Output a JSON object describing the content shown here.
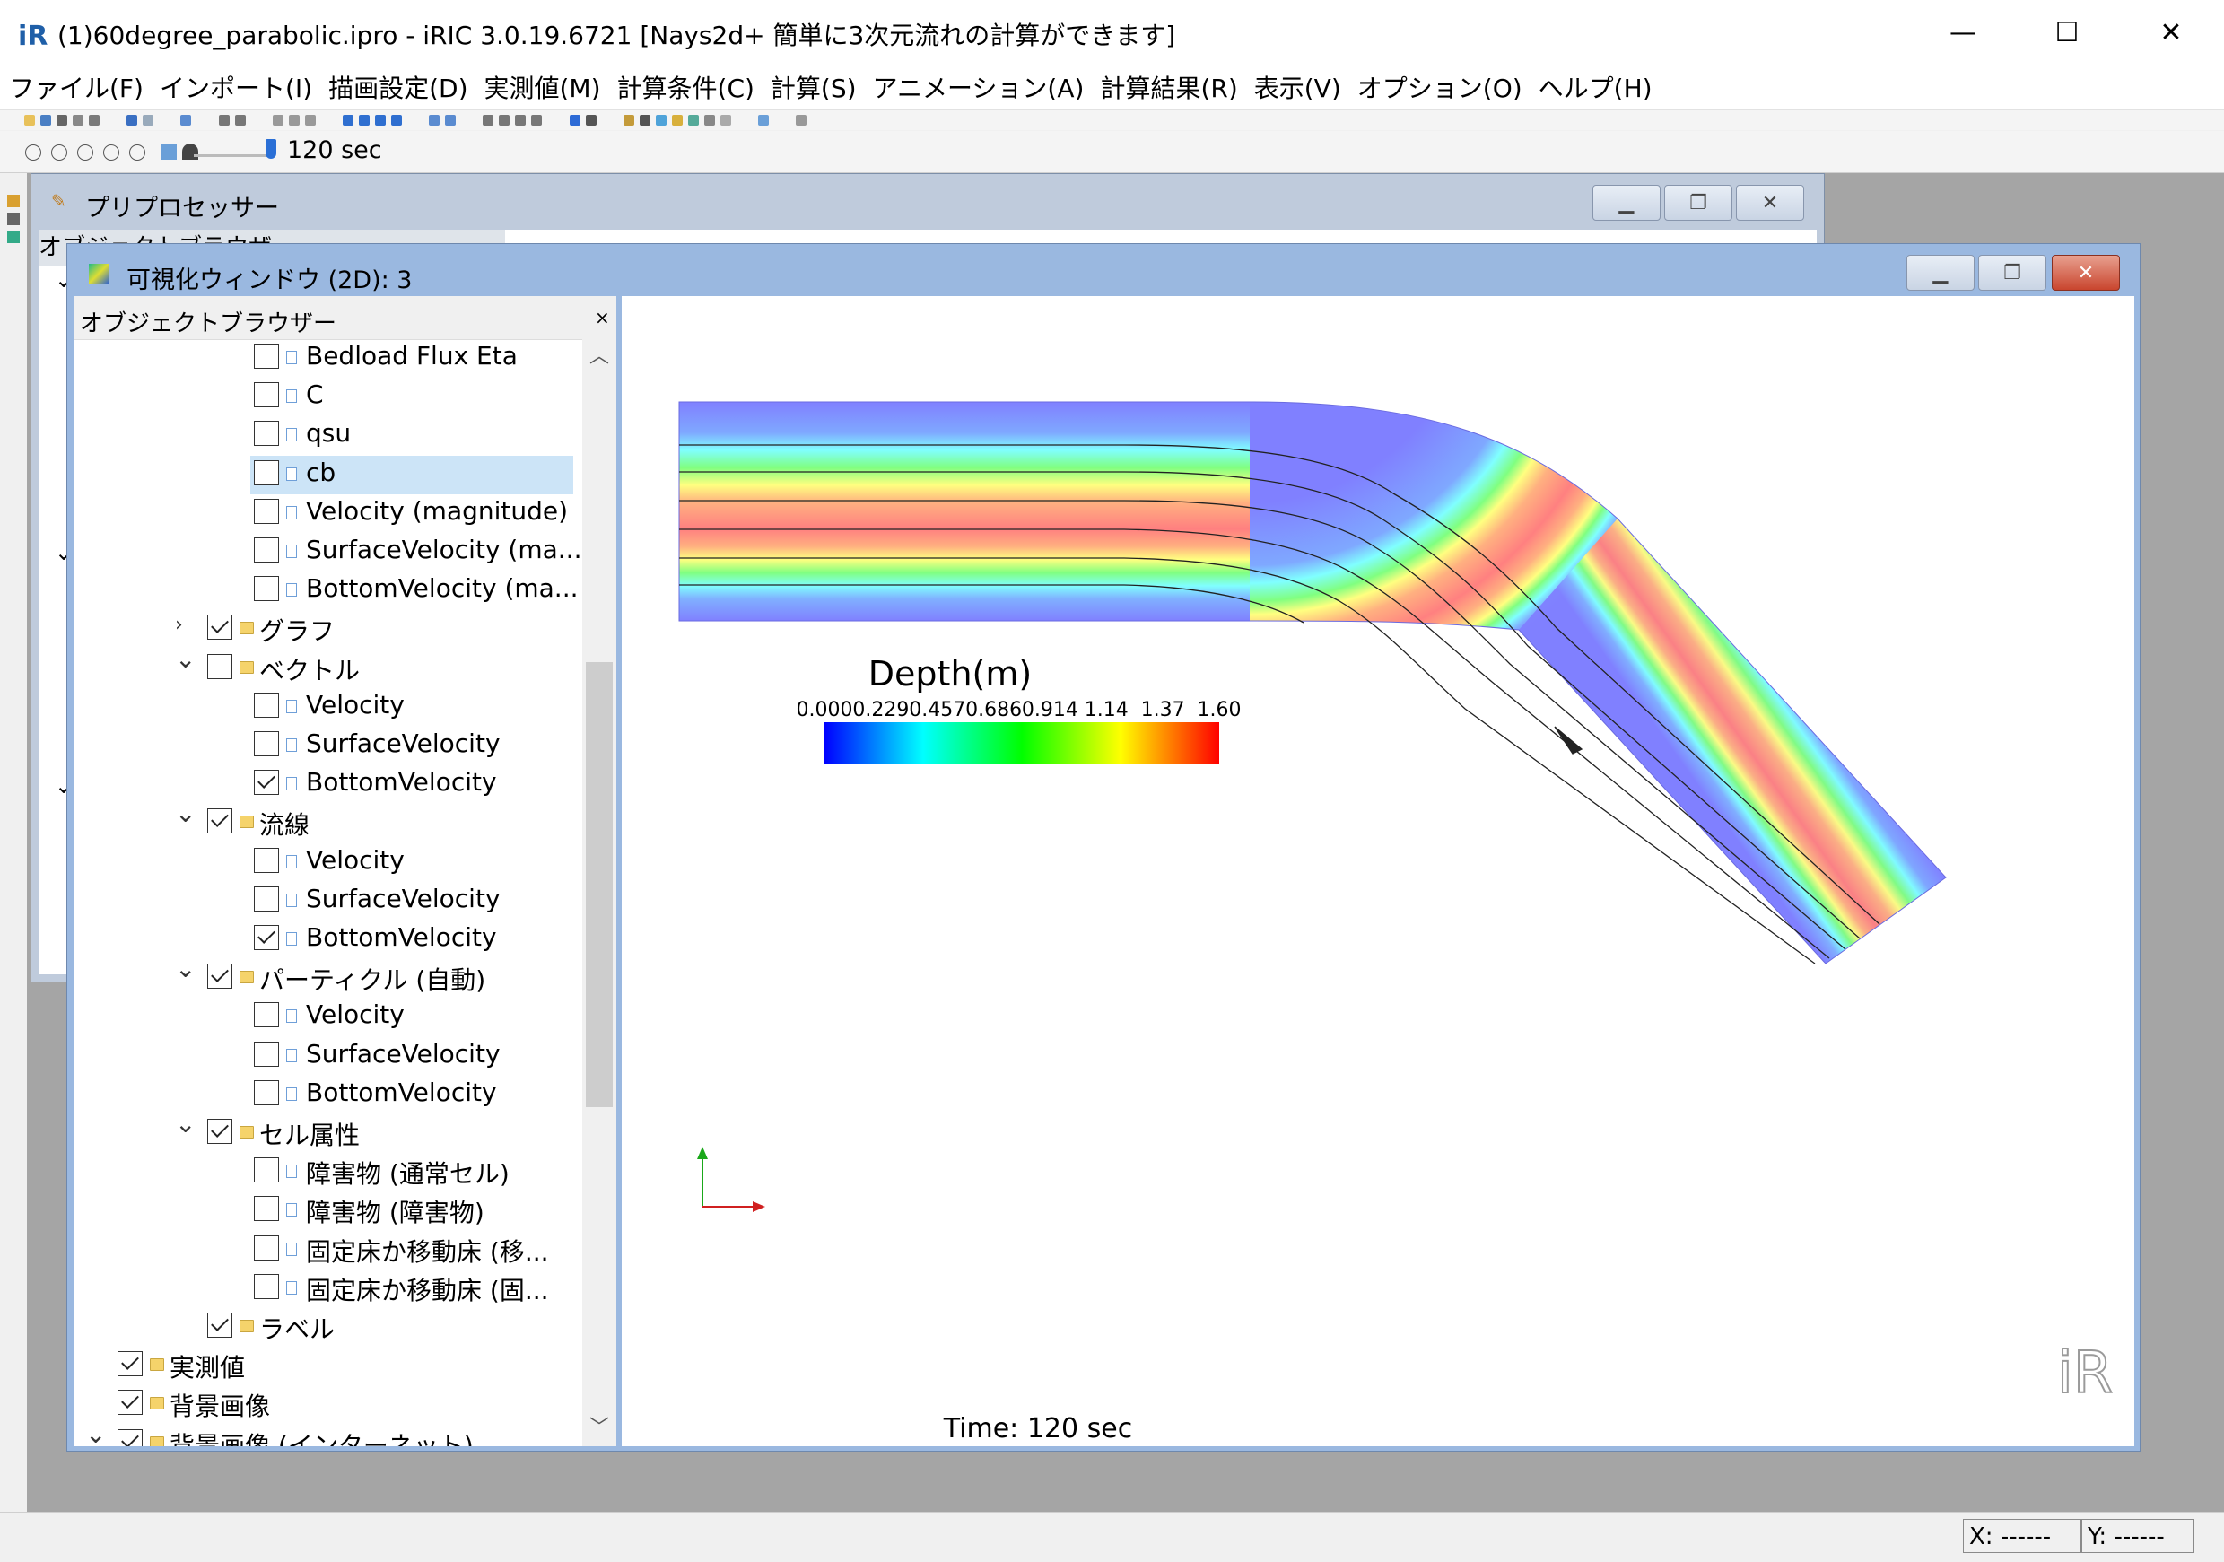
{
  "window": {
    "title": "(1)60degree_parabolic.ipro - iRIC 3.0.19.6721 [Nays2d+ 簡単に3次元流れの計算ができます]",
    "minimize": "—",
    "maximize": "☐",
    "close": "✕"
  },
  "menu": [
    "ファイル(F)",
    "インポート(I)",
    "描画設定(D)",
    "実測値(M)",
    "計算条件(C)",
    "計算(S)",
    "アニメーション(A)",
    "計算結果(R)",
    "表示(V)",
    "オプション(O)",
    "ヘルプ(H)"
  ],
  "animation": {
    "time_label": "120 sec"
  },
  "pre_window": {
    "title": "プリプロセッサー",
    "object_browser_title": "オブジェクトブラウザ"
  },
  "viz_window": {
    "title": "可視化ウィンドウ (2D): 3",
    "object_browser_title": "オブジェクトブラウザー",
    "close_x": "×"
  },
  "tree": [
    {
      "label": "Bedload Flux Eta",
      "level": 3,
      "checked": false,
      "icon": "doc"
    },
    {
      "label": "C",
      "level": 3,
      "checked": false,
      "icon": "doc"
    },
    {
      "label": "qsu",
      "level": 3,
      "checked": false,
      "icon": "doc"
    },
    {
      "label": "cb",
      "level": 3,
      "checked": false,
      "icon": "doc",
      "selected": true
    },
    {
      "label": "Velocity (magnitude)",
      "level": 3,
      "checked": false,
      "icon": "doc"
    },
    {
      "label": "SurfaceVelocity (ma...",
      "level": 3,
      "checked": false,
      "icon": "doc"
    },
    {
      "label": "BottomVelocity (ma...",
      "level": 3,
      "checked": false,
      "icon": "doc"
    },
    {
      "label": "グラフ",
      "level": 2,
      "checked": true,
      "icon": "folder",
      "expand": "collapsed"
    },
    {
      "label": "ベクトル",
      "level": 2,
      "checked": false,
      "icon": "folder",
      "expand": "expanded"
    },
    {
      "label": "Velocity",
      "level": 3,
      "checked": false,
      "icon": "doc"
    },
    {
      "label": "SurfaceVelocity",
      "level": 3,
      "checked": false,
      "icon": "doc"
    },
    {
      "label": "BottomVelocity",
      "level": 3,
      "checked": true,
      "icon": "doc"
    },
    {
      "label": "流線",
      "level": 2,
      "checked": true,
      "icon": "folder",
      "expand": "expanded"
    },
    {
      "label": "Velocity",
      "level": 3,
      "checked": false,
      "icon": "doc"
    },
    {
      "label": "SurfaceVelocity",
      "level": 3,
      "checked": false,
      "icon": "doc"
    },
    {
      "label": "BottomVelocity",
      "level": 3,
      "checked": true,
      "icon": "doc"
    },
    {
      "label": "パーティクル (自動)",
      "level": 2,
      "checked": true,
      "icon": "folder",
      "expand": "expanded"
    },
    {
      "label": "Velocity",
      "level": 3,
      "checked": false,
      "icon": "doc"
    },
    {
      "label": "SurfaceVelocity",
      "level": 3,
      "checked": false,
      "icon": "doc"
    },
    {
      "label": "BottomVelocity",
      "level": 3,
      "checked": false,
      "icon": "doc"
    },
    {
      "label": "セル属性",
      "level": 2,
      "checked": true,
      "icon": "folder",
      "expand": "expanded"
    },
    {
      "label": "障害物 (通常セル)",
      "level": 3,
      "checked": false,
      "icon": "doc"
    },
    {
      "label": "障害物 (障害物)",
      "level": 3,
      "checked": false,
      "icon": "doc"
    },
    {
      "label": "固定床か移動床 (移...",
      "level": 3,
      "checked": false,
      "icon": "doc"
    },
    {
      "label": "固定床か移動床 (固...",
      "level": 3,
      "checked": false,
      "icon": "doc"
    },
    {
      "label": "ラベル",
      "level": 2,
      "checked": true,
      "icon": "folder"
    },
    {
      "label": "実測値",
      "level": 1,
      "checked": true,
      "icon": "folder"
    },
    {
      "label": "背景画像",
      "level": 1,
      "checked": true,
      "icon": "folder"
    },
    {
      "label": "背景画像 (インターネット)",
      "level": 1,
      "checked": true,
      "icon": "folder",
      "expand": "expanded"
    }
  ],
  "legend": {
    "title": "Depth(m)",
    "ticks": [
      "0.000",
      "0.229",
      "0.457",
      "0.686",
      "0.914",
      "1.14",
      "1.37",
      "1.60"
    ],
    "colors": [
      "#0000ff",
      "#00ffff",
      "#00ff00",
      "#ffff00",
      "#ff0000"
    ]
  },
  "time_text": "Time: 120 sec",
  "status": {
    "x": "X: ------",
    "y": "Y: ------"
  }
}
